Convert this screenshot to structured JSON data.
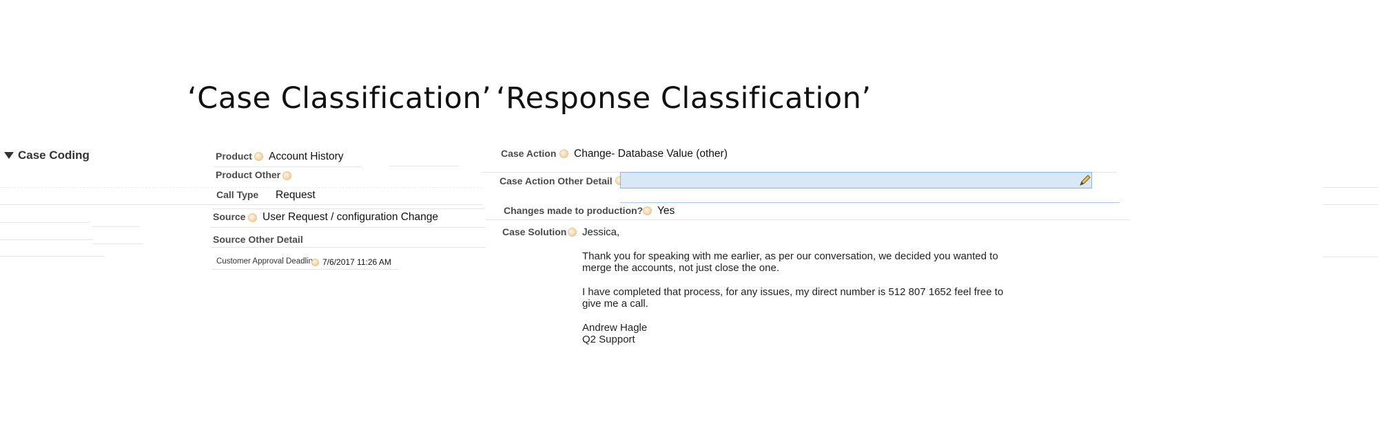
{
  "headings": {
    "case_classification": "‘Case Classification’",
    "response_classification": "‘Response Classification’"
  },
  "section": {
    "title": "Case Coding",
    "icon": "triangle-down-icon"
  },
  "case_fields": {
    "product": {
      "label": "Product",
      "value": "Account History"
    },
    "product_other": {
      "label": "Product Other",
      "value": ""
    },
    "call_type": {
      "label": "Call Type",
      "value": "Request"
    },
    "source": {
      "label": "Source",
      "value": "User Request / configuration Change"
    },
    "source_other_detail": {
      "label": "Source Other Detail",
      "value": ""
    },
    "customer_approval_deadline": {
      "label": "Customer Approval Deadline",
      "value": "7/6/2017 11:26 AM"
    }
  },
  "response_fields": {
    "case_action": {
      "label": "Case Action",
      "value": "Change- Database Value (other)"
    },
    "case_action_other_detail": {
      "label": "Case Action Other Detail",
      "value": ""
    },
    "changes_made_to_production": {
      "label": "Changes made to production?",
      "value": "Yes"
    },
    "case_solution": {
      "label": "Case Solution",
      "greeting": "Jessica,",
      "para1_line1": "Thank you for speaking with me earlier, as per our conversation, we decided you wanted to",
      "para1_line2": "merge the accounts, not just close the one.",
      "para2_line1": "I have completed that process, for any issues, my direct number is 512 807 1652 feel free to",
      "para2_line2": "give me a call.",
      "signature_name": "Andrew Hagle",
      "signature_team": "Q2 Support"
    }
  },
  "icons": {
    "help": "help-bubble-icon",
    "edit": "pencil-icon"
  },
  "colors": {
    "input_bg": "#d9e8f8",
    "input_border": "#8fb4dc",
    "help_bubble": "#f3d7a8"
  }
}
